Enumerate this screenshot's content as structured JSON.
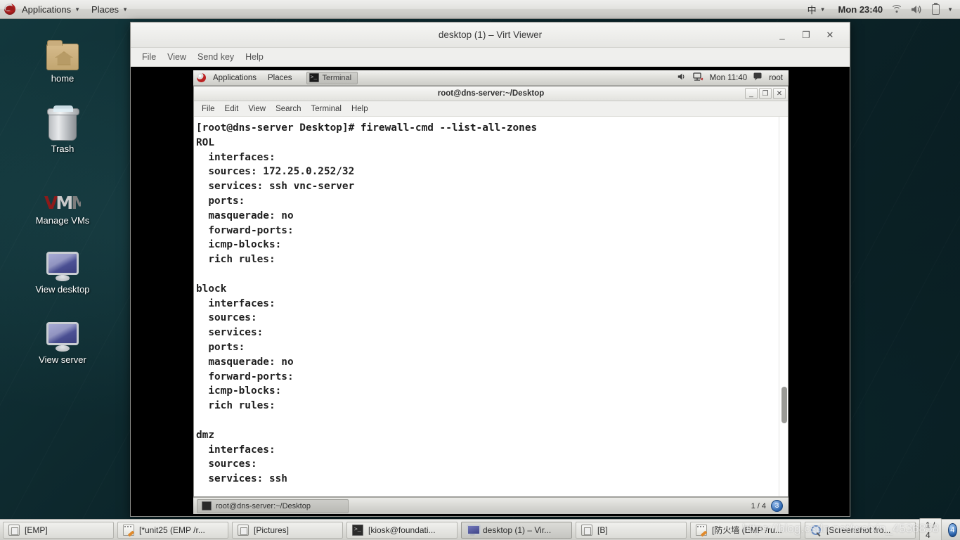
{
  "host_panel": {
    "applications_label": "Applications",
    "places_label": "Places",
    "input_method": "中",
    "clock": "Mon 23:40",
    "icons": [
      "redhat-logo",
      "wifi-icon",
      "volume-icon",
      "battery-icon",
      "chevron-down-icon"
    ]
  },
  "desktop_icons": [
    {
      "label": "home",
      "icon": "folder-icon"
    },
    {
      "label": "Trash",
      "icon": "trash-icon"
    },
    {
      "label": "Manage VMs",
      "icon": "vmm-icon"
    },
    {
      "label": "View desktop",
      "icon": "monitor-icon"
    },
    {
      "label": "View server",
      "icon": "monitor-icon"
    }
  ],
  "virt_viewer": {
    "title": "desktop (1) – Virt Viewer",
    "menus": [
      "File",
      "View",
      "Send key",
      "Help"
    ],
    "window_controls": {
      "minimize": "_",
      "maximize": "❐",
      "close": "✕"
    }
  },
  "guest_panel": {
    "applications_label": "Applications",
    "places_label": "Places",
    "active_window": "Terminal",
    "clock": "Mon 11:40",
    "user": "root",
    "icons": [
      "redhat-logo",
      "volume-icon",
      "network-icon",
      "user-icon"
    ]
  },
  "terminal": {
    "title": "root@dns-server:~/Desktop",
    "menus": [
      "File",
      "Edit",
      "View",
      "Search",
      "Terminal",
      "Help"
    ],
    "window_controls": {
      "minimize": "_",
      "maximize": "❐",
      "close": "✕"
    },
    "prompt": "[root@dns-server Desktop]#",
    "command": "firewall-cmd --list-all-zones",
    "output": "[root@dns-server Desktop]# firewall-cmd --list-all-zones\nROL\n  interfaces:\n  sources: 172.25.0.252/32\n  services: ssh vnc-server\n  ports:\n  masquerade: no\n  forward-ports:\n  icmp-blocks:\n  rich rules:\n\nblock\n  interfaces:\n  sources:\n  services:\n  ports:\n  masquerade: no\n  forward-ports:\n  icmp-blocks:\n  rich rules:\n\ndmz\n  interfaces:\n  sources:\n  services: ssh",
    "zones": [
      {
        "name": "ROL",
        "interfaces": "",
        "sources": "172.25.0.252/32",
        "services": "ssh vnc-server",
        "ports": "",
        "masquerade": "no",
        "forward_ports": "",
        "icmp_blocks": "",
        "rich_rules": ""
      },
      {
        "name": "block",
        "interfaces": "",
        "sources": "",
        "services": "",
        "ports": "",
        "masquerade": "no",
        "forward_ports": "",
        "icmp_blocks": "",
        "rich_rules": ""
      },
      {
        "name": "dmz",
        "interfaces": "",
        "sources": "",
        "services": "ssh"
      }
    ]
  },
  "guest_taskbar": {
    "task_label": "root@dns-server:~/Desktop",
    "workspace_indicator": "1 / 4",
    "workspace_badge": "3"
  },
  "host_taskbar": {
    "items": [
      {
        "label": "[EMP]",
        "icon": "archive-icon",
        "active": false
      },
      {
        "label": "[*unit25 (EMP /r...",
        "icon": "notepad-icon",
        "active": false
      },
      {
        "label": "[Pictures]",
        "icon": "archive-icon",
        "active": false
      },
      {
        "label": "[kiosk@foundati...",
        "icon": "terminal-icon",
        "active": false
      },
      {
        "label": "desktop (1) – Vir...",
        "icon": "monitor-icon",
        "active": true
      },
      {
        "label": "[B]",
        "icon": "archive-icon",
        "active": false
      },
      {
        "label": "[防火墙 (EMP /ru...",
        "icon": "notepad-icon",
        "active": false
      },
      {
        "label": "[Screenshot fro...",
        "icon": "magnifier-icon",
        "active": false
      }
    ],
    "workspace_indicator": "1 / 4",
    "workspace_badge": "4"
  },
  "watermark": "https://blog.csdn.net/weixin_4536858"
}
